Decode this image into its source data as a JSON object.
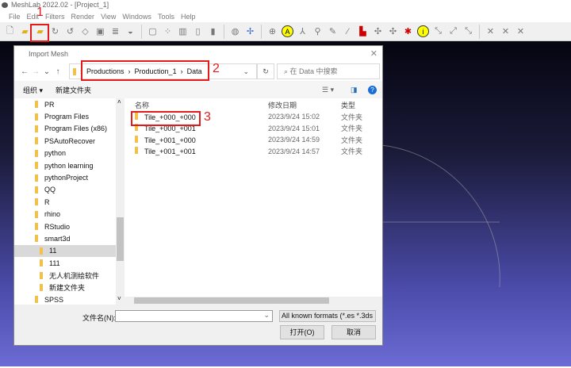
{
  "app": {
    "title": "MeshLab 2022.02 - [Project_1]",
    "menu": [
      "File",
      "Edit",
      "Filters",
      "Render",
      "View",
      "Windows",
      "Tools",
      "Help"
    ]
  },
  "annotations": {
    "step1": "1",
    "step2": "2",
    "step3": "3"
  },
  "dialog": {
    "title": "Import Mesh",
    "path": [
      "Productions",
      "Production_1",
      "Data"
    ],
    "search_placeholder": "在 Data 中搜索",
    "organize": "组织 ▾",
    "new_folder": "新建文件夹",
    "sidebar": [
      {
        "label": "PR"
      },
      {
        "label": "Program Files"
      },
      {
        "label": "Program Files (x86)"
      },
      {
        "label": "PSAutoRecover"
      },
      {
        "label": "python"
      },
      {
        "label": "python learning"
      },
      {
        "label": "pythonProject"
      },
      {
        "label": "QQ"
      },
      {
        "label": "R"
      },
      {
        "label": "rhino"
      },
      {
        "label": "RStudio"
      },
      {
        "label": "smart3d"
      },
      {
        "label": "11"
      },
      {
        "label": "111"
      },
      {
        "label": "无人机测绘软件"
      },
      {
        "label": "新建文件夹"
      },
      {
        "label": "SPSS"
      }
    ],
    "columns": {
      "name": "名称",
      "date": "修改日期",
      "type": "类型"
    },
    "files": [
      {
        "name": "Tile_+000_+000",
        "date": "2023/9/24 15:02",
        "type": "文件夹"
      },
      {
        "name": "Tile_+000_+001",
        "date": "2023/9/24 15:01",
        "type": "文件夹"
      },
      {
        "name": "Tile_+001_+000",
        "date": "2023/9/24 14:59",
        "type": "文件夹"
      },
      {
        "name": "Tile_+001_+001",
        "date": "2023/9/24 14:57",
        "type": "文件夹"
      }
    ],
    "filename_label": "文件名(N):",
    "filename_value": "",
    "filter": "All known formats (*.es *.3ds",
    "open": "打开(O)",
    "cancel": "取消"
  }
}
